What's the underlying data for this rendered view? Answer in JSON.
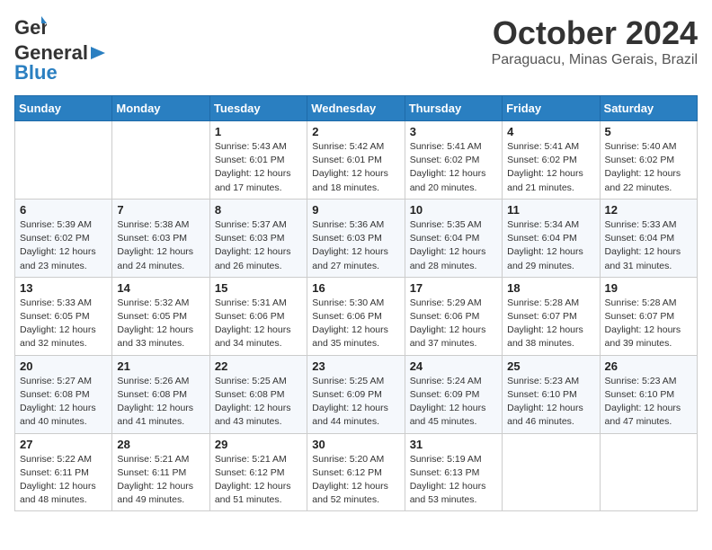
{
  "header": {
    "logo": {
      "general": "General",
      "blue": "Blue"
    },
    "title": "October 2024",
    "location": "Paraguacu, Minas Gerais, Brazil"
  },
  "calendar": {
    "weekdays": [
      "Sunday",
      "Monday",
      "Tuesday",
      "Wednesday",
      "Thursday",
      "Friday",
      "Saturday"
    ],
    "weeks": [
      [
        {
          "day": "",
          "info": ""
        },
        {
          "day": "",
          "info": ""
        },
        {
          "day": "1",
          "info": "Sunrise: 5:43 AM\nSunset: 6:01 PM\nDaylight: 12 hours\nand 17 minutes."
        },
        {
          "day": "2",
          "info": "Sunrise: 5:42 AM\nSunset: 6:01 PM\nDaylight: 12 hours\nand 18 minutes."
        },
        {
          "day": "3",
          "info": "Sunrise: 5:41 AM\nSunset: 6:02 PM\nDaylight: 12 hours\nand 20 minutes."
        },
        {
          "day": "4",
          "info": "Sunrise: 5:41 AM\nSunset: 6:02 PM\nDaylight: 12 hours\nand 21 minutes."
        },
        {
          "day": "5",
          "info": "Sunrise: 5:40 AM\nSunset: 6:02 PM\nDaylight: 12 hours\nand 22 minutes."
        }
      ],
      [
        {
          "day": "6",
          "info": "Sunrise: 5:39 AM\nSunset: 6:02 PM\nDaylight: 12 hours\nand 23 minutes."
        },
        {
          "day": "7",
          "info": "Sunrise: 5:38 AM\nSunset: 6:03 PM\nDaylight: 12 hours\nand 24 minutes."
        },
        {
          "day": "8",
          "info": "Sunrise: 5:37 AM\nSunset: 6:03 PM\nDaylight: 12 hours\nand 26 minutes."
        },
        {
          "day": "9",
          "info": "Sunrise: 5:36 AM\nSunset: 6:03 PM\nDaylight: 12 hours\nand 27 minutes."
        },
        {
          "day": "10",
          "info": "Sunrise: 5:35 AM\nSunset: 6:04 PM\nDaylight: 12 hours\nand 28 minutes."
        },
        {
          "day": "11",
          "info": "Sunrise: 5:34 AM\nSunset: 6:04 PM\nDaylight: 12 hours\nand 29 minutes."
        },
        {
          "day": "12",
          "info": "Sunrise: 5:33 AM\nSunset: 6:04 PM\nDaylight: 12 hours\nand 31 minutes."
        }
      ],
      [
        {
          "day": "13",
          "info": "Sunrise: 5:33 AM\nSunset: 6:05 PM\nDaylight: 12 hours\nand 32 minutes."
        },
        {
          "day": "14",
          "info": "Sunrise: 5:32 AM\nSunset: 6:05 PM\nDaylight: 12 hours\nand 33 minutes."
        },
        {
          "day": "15",
          "info": "Sunrise: 5:31 AM\nSunset: 6:06 PM\nDaylight: 12 hours\nand 34 minutes."
        },
        {
          "day": "16",
          "info": "Sunrise: 5:30 AM\nSunset: 6:06 PM\nDaylight: 12 hours\nand 35 minutes."
        },
        {
          "day": "17",
          "info": "Sunrise: 5:29 AM\nSunset: 6:06 PM\nDaylight: 12 hours\nand 37 minutes."
        },
        {
          "day": "18",
          "info": "Sunrise: 5:28 AM\nSunset: 6:07 PM\nDaylight: 12 hours\nand 38 minutes."
        },
        {
          "day": "19",
          "info": "Sunrise: 5:28 AM\nSunset: 6:07 PM\nDaylight: 12 hours\nand 39 minutes."
        }
      ],
      [
        {
          "day": "20",
          "info": "Sunrise: 5:27 AM\nSunset: 6:08 PM\nDaylight: 12 hours\nand 40 minutes."
        },
        {
          "day": "21",
          "info": "Sunrise: 5:26 AM\nSunset: 6:08 PM\nDaylight: 12 hours\nand 41 minutes."
        },
        {
          "day": "22",
          "info": "Sunrise: 5:25 AM\nSunset: 6:08 PM\nDaylight: 12 hours\nand 43 minutes."
        },
        {
          "day": "23",
          "info": "Sunrise: 5:25 AM\nSunset: 6:09 PM\nDaylight: 12 hours\nand 44 minutes."
        },
        {
          "day": "24",
          "info": "Sunrise: 5:24 AM\nSunset: 6:09 PM\nDaylight: 12 hours\nand 45 minutes."
        },
        {
          "day": "25",
          "info": "Sunrise: 5:23 AM\nSunset: 6:10 PM\nDaylight: 12 hours\nand 46 minutes."
        },
        {
          "day": "26",
          "info": "Sunrise: 5:23 AM\nSunset: 6:10 PM\nDaylight: 12 hours\nand 47 minutes."
        }
      ],
      [
        {
          "day": "27",
          "info": "Sunrise: 5:22 AM\nSunset: 6:11 PM\nDaylight: 12 hours\nand 48 minutes."
        },
        {
          "day": "28",
          "info": "Sunrise: 5:21 AM\nSunset: 6:11 PM\nDaylight: 12 hours\nand 49 minutes."
        },
        {
          "day": "29",
          "info": "Sunrise: 5:21 AM\nSunset: 6:12 PM\nDaylight: 12 hours\nand 51 minutes."
        },
        {
          "day": "30",
          "info": "Sunrise: 5:20 AM\nSunset: 6:12 PM\nDaylight: 12 hours\nand 52 minutes."
        },
        {
          "day": "31",
          "info": "Sunrise: 5:19 AM\nSunset: 6:13 PM\nDaylight: 12 hours\nand 53 minutes."
        },
        {
          "day": "",
          "info": ""
        },
        {
          "day": "",
          "info": ""
        }
      ]
    ]
  }
}
